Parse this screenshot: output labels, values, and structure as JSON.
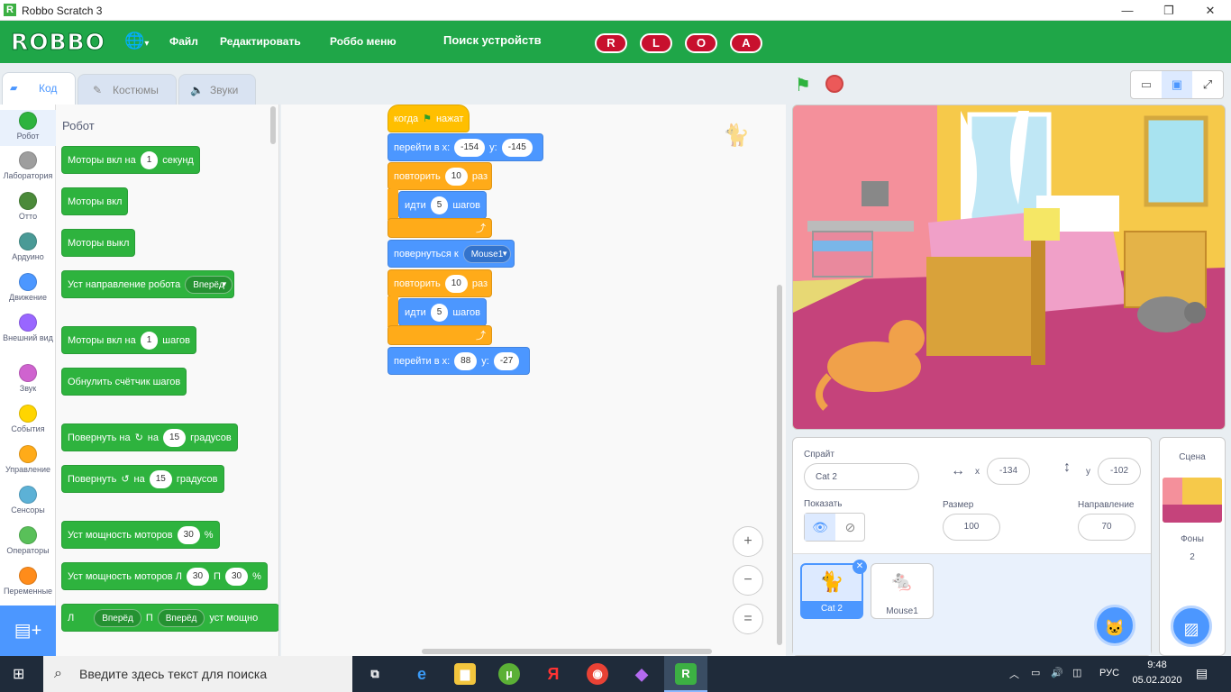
{
  "window": {
    "title": "Robbo Scratch 3",
    "controls": {
      "minimize": "—",
      "maximize": "❐",
      "close": "✕"
    }
  },
  "menu": {
    "logo": "ROBBO",
    "file": "Файл",
    "edit": "Редактировать",
    "robbo_menu": "Роббо меню",
    "search_devices": "Поиск устройств",
    "buttons": [
      "R",
      "L",
      "O",
      "A"
    ]
  },
  "tabs": {
    "code": "Код",
    "costumes": "Костюмы",
    "sounds": "Звуки"
  },
  "categories": [
    {
      "label": "Робот",
      "color": "#2eb33e"
    },
    {
      "label": "Лаборатория",
      "color": "#9e9e9e"
    },
    {
      "label": "Отто",
      "color": "#4b8a3a"
    },
    {
      "label": "Ардуино",
      "color": "#4a9a96"
    },
    {
      "label": "Движение",
      "color": "#4c97ff"
    },
    {
      "label": "Внешний вид",
      "color": "#9966ff"
    },
    {
      "label": "Звук",
      "color": "#cf63cf"
    },
    {
      "label": "События",
      "color": "#ffd500"
    },
    {
      "label": "Управление",
      "color": "#ffab19"
    },
    {
      "label": "Сенсоры",
      "color": "#5cb1d6"
    },
    {
      "label": "Операторы",
      "color": "#59c059"
    },
    {
      "label": "Переменные",
      "color": "#ff8c1a"
    }
  ],
  "palette": {
    "title": "Робот",
    "b1": {
      "a": "Моторы вкл на",
      "v": "1",
      "b": "секунд"
    },
    "b2": "Моторы вкл",
    "b3": "Моторы выкл",
    "b4": {
      "a": "Уст направление робота",
      "dd": "Вперёд"
    },
    "b5": {
      "a": "Моторы вкл на",
      "v": "1",
      "b": "шагов"
    },
    "b6": "Обнулить счётчик шагов",
    "b7": {
      "a": "Повернуть на",
      "b": "на",
      "v": "15",
      "c": "градусов"
    },
    "b8": {
      "a": "Повернуть",
      "b": "на",
      "v": "15",
      "c": "градусов"
    },
    "b9": {
      "a": "Уст мощность моторов",
      "v": "30",
      "b": "%"
    },
    "b10": {
      "a": "Уст мощность моторов Л",
      "v1": "30",
      "m": "П",
      "v2": "30",
      "b": "%"
    },
    "b11": {
      "a": "Л",
      "dd1": "Вперёд",
      "m": "П",
      "dd2": "Вперёд",
      "b": "уст мощно"
    }
  },
  "script": {
    "hat": {
      "a": "когда",
      "b": "нажат"
    },
    "goto1": {
      "a": "перейти в x:",
      "x": "-154",
      "m": "y:",
      "y": "-145"
    },
    "repeat1": {
      "a": "повторить",
      "v": "10",
      "b": "раз"
    },
    "move1": {
      "a": "идти",
      "v": "5",
      "b": "шагов"
    },
    "point": {
      "a": "повернуться к",
      "dd": "Mouse1"
    },
    "repeat2": {
      "a": "повторить",
      "v": "10",
      "b": "раз"
    },
    "move2": {
      "a": "идти",
      "v": "5",
      "b": "шагов"
    },
    "goto2": {
      "a": "перейти в x:",
      "x": "88",
      "m": "y:",
      "y": "-27"
    }
  },
  "zoom": {
    "in": "+",
    "out": "−",
    "reset": "="
  },
  "sprite": {
    "label": "Спрайт",
    "name": "Cat 2",
    "x_label": "x",
    "x": "-134",
    "y_label": "y",
    "y": "-102",
    "show_label": "Показать",
    "size_label": "Размер",
    "size": "100",
    "direction_label": "Направление",
    "direction": "70",
    "list": [
      "Cat 2",
      "Mouse1"
    ]
  },
  "scene": {
    "label": "Сцена",
    "backdrops_label": "Фоны",
    "backdrops_count": "2"
  },
  "taskbar": {
    "search": "Введите здесь текст для поиска",
    "lang": "РУС",
    "time": "9:48",
    "date": "05.02.2020"
  }
}
